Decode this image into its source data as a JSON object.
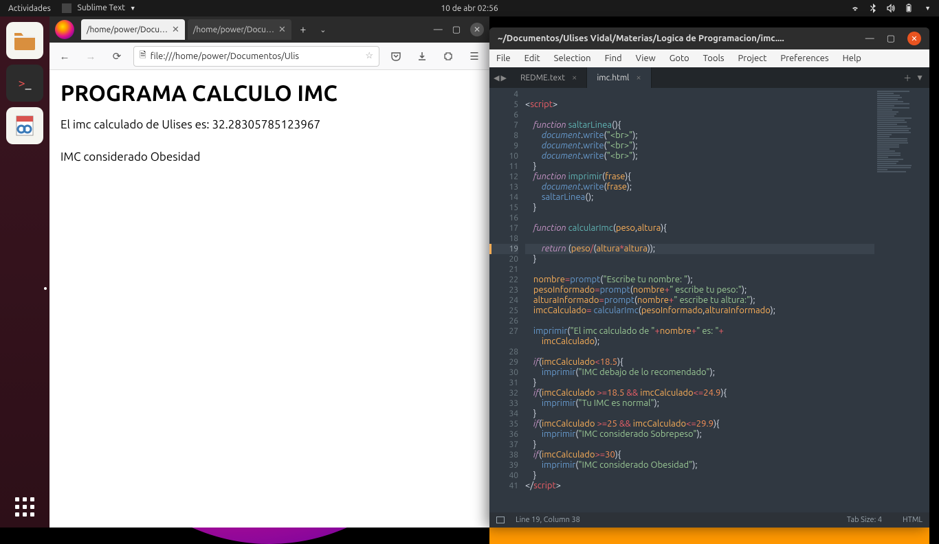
{
  "topbar": {
    "activities": "Actividades",
    "app_name": "Sublime Text",
    "datetime": "10 de abr  02:56"
  },
  "firefox": {
    "tabs": [
      {
        "title": "/home/power/Docu…",
        "active": true
      },
      {
        "title": "/home/power/Docu…",
        "active": false
      }
    ],
    "url": "file:///home/power/Documentos/Ulis",
    "page": {
      "heading": "PROGRAMA CALCULO IMC",
      "line1": "El imc calculado de Ulises es: 32.28305785123967",
      "line2": "IMC considerado Obesidad"
    }
  },
  "sublime": {
    "title": "~/Documentos/Ulises Vidal/Materias/Logica de Programacion/imc....",
    "menu": [
      "File",
      "Edit",
      "Selection",
      "Find",
      "View",
      "Goto",
      "Tools",
      "Project",
      "Preferences",
      "Help"
    ],
    "tabs": [
      {
        "name": "REDME.text",
        "active": false
      },
      {
        "name": "imc.html",
        "active": true
      }
    ],
    "status": {
      "position": "Line 19, Column 38",
      "tabsize": "Tab Size: 4",
      "syntax": "HTML"
    },
    "code_lines": [
      4,
      5,
      6,
      7,
      8,
      9,
      10,
      11,
      12,
      13,
      14,
      15,
      16,
      17,
      18,
      19,
      20,
      21,
      22,
      23,
      24,
      25,
      26,
      27,
      "",
      28,
      29,
      30,
      31,
      32,
      33,
      34,
      35,
      36,
      37,
      38,
      39,
      40,
      41
    ],
    "highlight_line": 19
  }
}
